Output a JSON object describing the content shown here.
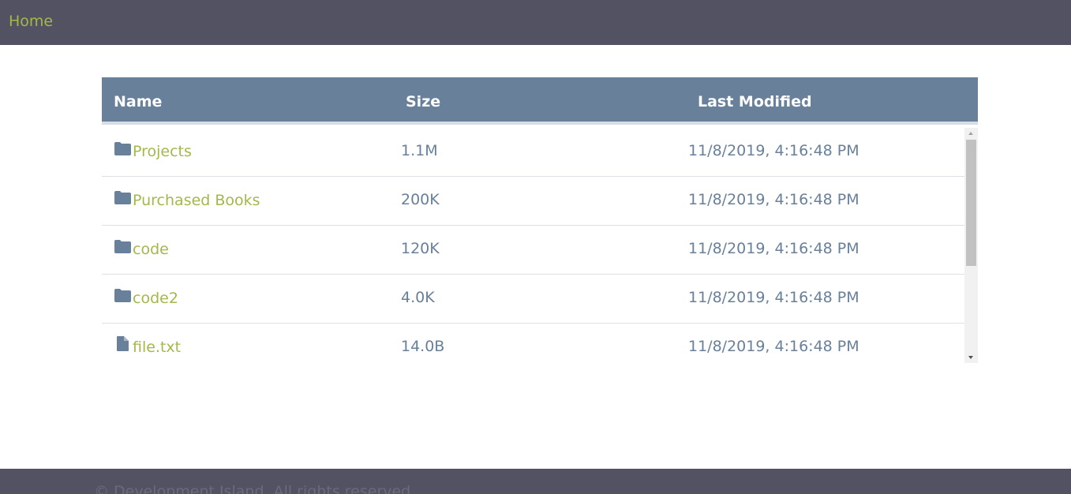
{
  "nav": {
    "home_label": "Home"
  },
  "table": {
    "columns": {
      "name": "Name",
      "size": "Size",
      "modified": "Last Modified"
    },
    "rows": [
      {
        "icon": "folder-icon",
        "name": "Projects",
        "size": "1.1M",
        "modified": "11/8/2019, 4:16:48 PM"
      },
      {
        "icon": "folder-icon",
        "name": "Purchased Books",
        "size": "200K",
        "modified": "11/8/2019, 4:16:48 PM"
      },
      {
        "icon": "folder-icon",
        "name": "code",
        "size": "120K",
        "modified": "11/8/2019, 4:16:48 PM"
      },
      {
        "icon": "folder-icon",
        "name": "code2",
        "size": "4.0K",
        "modified": "11/8/2019, 4:16:48 PM"
      },
      {
        "icon": "file-icon",
        "name": "file.txt",
        "size": "14.0B",
        "modified": "11/8/2019, 4:16:48 PM"
      }
    ]
  },
  "footer": {
    "text": "© Development Island. All rights reserved."
  },
  "colors": {
    "header_bar": "#525263",
    "accent_green": "#a3b84a",
    "table_header": "#68809a",
    "muted_text": "#68809a"
  }
}
